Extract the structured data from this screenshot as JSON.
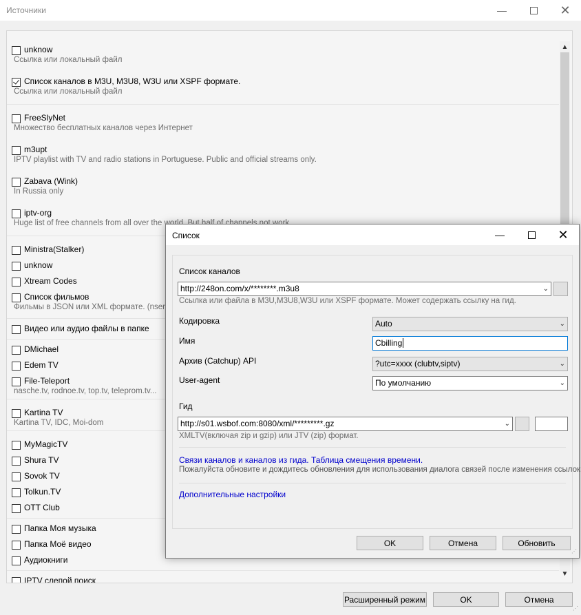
{
  "window": {
    "title": "Источники"
  },
  "sources": [
    {
      "name": "unknow",
      "desc": "Ссылка или локальный файл",
      "checked": false
    },
    {
      "name": "Список каналов в M3U, M3U8, W3U или XSPF формате.",
      "desc": "Ссылка или локальный файл",
      "checked": true
    },
    {
      "name": "FreeSlyNet",
      "desc": "Множество бесплатных каналов через Интернет",
      "checked": false
    },
    {
      "name": "m3upt",
      "desc": "IPTV playlist with TV and radio stations in Portuguese. Public and official streams only.",
      "checked": false
    },
    {
      "name": "Zabava (Wink)",
      "desc": "In Russia only",
      "checked": false
    },
    {
      "name": "iptv-org",
      "desc": "Huge list of free channels from all over the world. But half of channels not work.",
      "checked": false
    },
    {
      "name": "Ministra(Stalker)",
      "desc": "",
      "checked": false
    },
    {
      "name": "unknow",
      "desc": "",
      "checked": false
    },
    {
      "name": "Xtream Codes",
      "desc": "",
      "checked": false
    },
    {
      "name": "Список фильмов",
      "desc": "Фильмы в JSON или XML формате. (nserv,...",
      "checked": false
    },
    {
      "name": "Видео или аудио файлы в папке",
      "desc": "",
      "checked": false
    },
    {
      "name": "DMichael",
      "desc": "",
      "checked": false
    },
    {
      "name": "Edem TV",
      "desc": "",
      "checked": false
    },
    {
      "name": "File-Teleport",
      "desc": "nasche.tv, rodnoe.tv, top.tv, teleprom.tv...",
      "checked": false
    },
    {
      "name": "Kartina TV",
      "desc": "Kartina TV, IDC, Moi-dom",
      "checked": false
    },
    {
      "name": "MyMagicTV",
      "desc": "",
      "checked": false
    },
    {
      "name": "Shura TV",
      "desc": "",
      "checked": false
    },
    {
      "name": "Sovok TV",
      "desc": "",
      "checked": false
    },
    {
      "name": "Tolkun.TV",
      "desc": "",
      "checked": false
    },
    {
      "name": "OTT Club",
      "desc": "",
      "checked": false
    },
    {
      "name": "Папка Моя музыка",
      "desc": "",
      "checked": false
    },
    {
      "name": "Папка Моё видео",
      "desc": "",
      "checked": false
    },
    {
      "name": "Аудиокниги",
      "desc": "",
      "checked": false
    },
    {
      "name": "IPTV слепой поиск",
      "desc": "",
      "checked": false
    }
  ],
  "main_buttons": {
    "advanced": "Расширенный режим",
    "ok": "OK",
    "cancel": "Отмена"
  },
  "dialog": {
    "title": "Список",
    "channels_label": "Список каналов",
    "channels_url": "http://248on.com/x/********.m3u8",
    "channels_hint": "Ссылка или файла в M3U,M3U8,W3U или XSPF формате. Может содержать ссылку на гид.",
    "encoding_label": "Кодировка",
    "encoding_value": "Auto",
    "name_label": "Имя",
    "name_value": "Cbilling",
    "archive_label": "Архив (Catchup) API",
    "archive_value": "?utc=xxxx (clubtv,siptv)",
    "useragent_label": "User-agent",
    "useragent_value": "По умолчанию",
    "guide_label": "Гид",
    "guide_url": "http://s01.wsbof.com:8080/xml/*********.gz",
    "guide_offset": "",
    "guide_hint": "XMLTV(включая zip и gzip) или JTV (zip) формат.",
    "links_link": "Связи каналов и каналов из гида. Таблица смещения времени.",
    "links_hint": "Пожалуйста обновите и дождитесь обновления для использования диалога связей после изменения ссылок.",
    "advanced_link": "Дополнительные настройки",
    "ok": "OK",
    "cancel": "Отмена",
    "refresh": "Обновить"
  }
}
